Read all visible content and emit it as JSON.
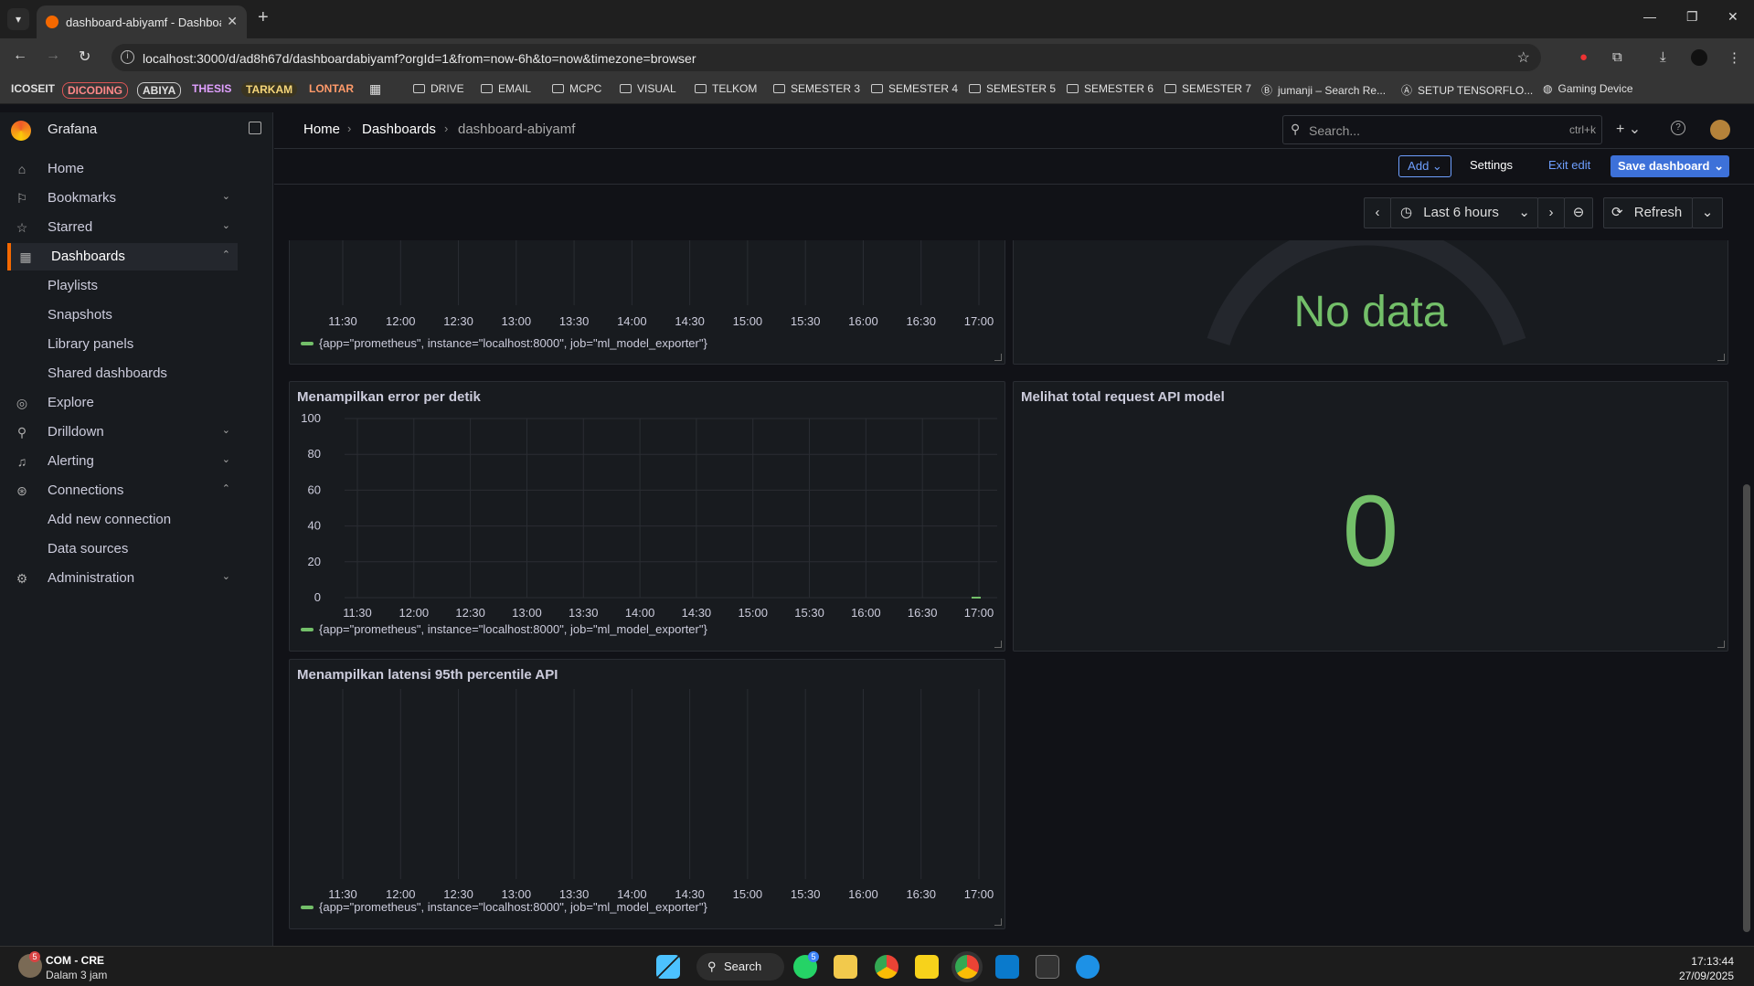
{
  "browser": {
    "tab_title": "dashboard-abiyamf - Dashboar",
    "url": "localhost:3000/d/ad8h67d/dashboardabiyamf?orgId=1&from=now-6h&to=now&timezone=browser",
    "bookmarks": [
      "ICOSEIT",
      "DICODING",
      "ABIYA",
      "THESIS",
      "TARKAM",
      "LONTAR",
      "DRIVE",
      "EMAIL",
      "MCPC",
      "VISUAL",
      "TELKOM",
      "SEMESTER 3",
      "SEMESTER 4",
      "SEMESTER 5",
      "SEMESTER 6",
      "SEMESTER 7",
      "jumanji – Search Re...",
      "SETUP TENSORFLO...",
      "Gaming Device"
    ]
  },
  "grafana": {
    "app_name": "Grafana",
    "breadcrumb": [
      "Home",
      "Dashboards",
      "dashboard-abiyamf"
    ],
    "search_placeholder": "Search...",
    "search_shortcut": "ctrl+k",
    "nav": {
      "home": "Home",
      "bookmarks": "Bookmarks",
      "starred": "Starred",
      "dashboards": "Dashboards",
      "playlists": "Playlists",
      "snapshots": "Snapshots",
      "library_panels": "Library panels",
      "shared_dashboards": "Shared dashboards",
      "explore": "Explore",
      "drilldown": "Drilldown",
      "alerting": "Alerting",
      "connections": "Connections",
      "add_new_connection": "Add new connection",
      "data_sources": "Data sources",
      "administration": "Administration"
    },
    "toolbar": {
      "add": "Add",
      "settings": "Settings",
      "exit_edit": "Exit edit",
      "save": "Save dashboard",
      "time_range": "Last 6 hours",
      "refresh": "Refresh"
    }
  },
  "panels": {
    "top_left_legend": "{app=\"prometheus\", instance=\"localhost:8000\", job=\"ml_model_exporter\"}",
    "top_right_value": "No data",
    "error_title": "Menampilkan error per detik",
    "error_legend": "{app=\"prometheus\", instance=\"localhost:8000\", job=\"ml_model_exporter\"}",
    "total_title": "Melihat total request API model",
    "total_value": "0",
    "latency_title": "Menampilkan latensi 95th percentile API",
    "latency_legend": "{app=\"prometheus\", instance=\"localhost:8000\", job=\"ml_model_exporter\"}"
  },
  "chart_data": [
    {
      "type": "line",
      "title": "",
      "x": [
        "11:30",
        "12:00",
        "12:30",
        "13:00",
        "13:30",
        "14:00",
        "14:30",
        "15:00",
        "15:30",
        "16:00",
        "16:30",
        "17:00"
      ],
      "series": [
        {
          "name": "{app=\"prometheus\", instance=\"localhost:8000\", job=\"ml_model_exporter\"}",
          "values": []
        }
      ],
      "grid": true
    },
    {
      "type": "line",
      "title": "Menampilkan error per detik",
      "x": [
        "11:30",
        "12:00",
        "12:30",
        "13:00",
        "13:30",
        "14:00",
        "14:30",
        "15:00",
        "15:30",
        "16:00",
        "16:30",
        "17:00"
      ],
      "y_ticks": [
        0,
        20,
        40,
        60,
        80,
        100
      ],
      "ylim": [
        0,
        100
      ],
      "series": [
        {
          "name": "{app=\"prometheus\", instance=\"localhost:8000\", job=\"ml_model_exporter\"}",
          "values": [
            0
          ]
        }
      ],
      "grid": true
    },
    {
      "type": "line",
      "title": "Menampilkan latensi 95th percentile API",
      "x": [
        "11:30",
        "12:00",
        "12:30",
        "13:00",
        "13:30",
        "14:00",
        "14:30",
        "15:00",
        "15:30",
        "16:00",
        "16:30",
        "17:00"
      ],
      "series": [
        {
          "name": "{app=\"prometheus\", instance=\"localhost:8000\", job=\"ml_model_exporter\"}",
          "values": []
        }
      ],
      "grid": true
    }
  ],
  "taskbar": {
    "weather_title": "COM - CRE",
    "weather_sub": "Dalam 3 jam",
    "weather_badge": "5",
    "search": "Search",
    "whatsapp_badge": "5",
    "time": "17:13:44",
    "date": "27/09/2025"
  },
  "colors": {
    "accent": "#f46800",
    "series": "#73bf69",
    "primary": "#3d71d9",
    "link": "#6e9fff"
  }
}
